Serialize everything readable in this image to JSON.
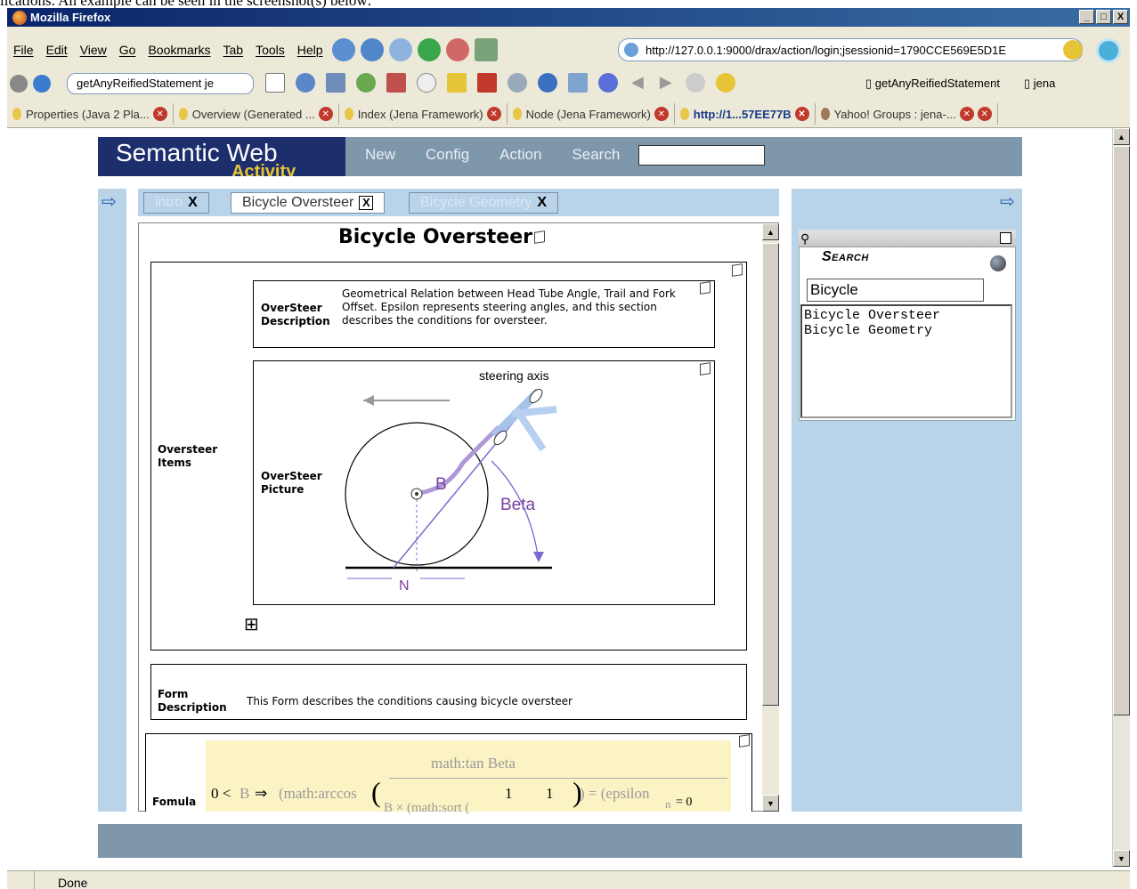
{
  "doc_snippet": "lications. An example can be seen in the screenshot(s) below:",
  "window": {
    "title": "Mozilla Firefox",
    "buttons": [
      "_",
      "□",
      "X"
    ]
  },
  "menu": [
    "File",
    "Edit",
    "View",
    "Go",
    "Bookmarks",
    "Tab",
    "Tools",
    "Help"
  ],
  "url": "http://127.0.0.1:9000/drax/action/login;jsessionid=1790CCE569E5D1E",
  "toolbar2": {
    "search_text": "getAnyReifiedStatement je",
    "bookmark1": "getAnyReifiedStatement",
    "bookmark2": "jena"
  },
  "browser_tabs": [
    {
      "label": "Properties (Java 2 Pla...",
      "active": false
    },
    {
      "label": "Overview (Generated ...",
      "active": false
    },
    {
      "label": "Index (Jena Framework)",
      "active": false
    },
    {
      "label": "Node (Jena Framework)",
      "active": false
    },
    {
      "label": "http://1...57EE77B",
      "active": true
    },
    {
      "label": "Yahoo! Groups : jena-...",
      "active": false
    }
  ],
  "app": {
    "logo": "Semantic Web",
    "logo_sub": "Activity",
    "nav": [
      "New",
      "Config",
      "Action",
      "Search"
    ],
    "tabs": [
      {
        "label": "intro",
        "close": "X",
        "state": "inactive"
      },
      {
        "label": "Bicycle Oversteer",
        "close": "X",
        "state": "active"
      },
      {
        "label": "Bicycle Geometry",
        "close": "X",
        "state": "inactive"
      }
    ],
    "page_title": "Bicycle Oversteer",
    "oversteer_items_label": "Oversteer Items",
    "oversteer_desc_label": "OverSteer Description",
    "oversteer_desc_text": "Geometrical Relation between Head Tube Angle, Trail and Fork Offset. Epsilon represents steering angles, and this section describes the conditions for oversteer.",
    "oversteer_pic_label": "OverSteer Picture",
    "figure_labels": {
      "steering": "steering axis",
      "b": "B",
      "beta": "Beta",
      "n": "N"
    },
    "expand_symbol": "⊞",
    "form_desc_label": "Form Description",
    "form_desc_text": "This Form describes the conditions causing bicycle oversteer",
    "formula_label": "Fomula",
    "formula": {
      "lhs": "0 <",
      "b": "B",
      "arrow": "⇒",
      "arccos": "(math:arccos",
      "tan": "math:tan Beta",
      "num1": "1",
      "num2": "1",
      "eq": ") = (epsilon",
      "sub": "n",
      "eq0": "= 0",
      "denom": "B × (math:sort ("
    },
    "search_widget": {
      "title": "Search",
      "query": "Bicycle",
      "results": [
        "Bicycle Oversteer",
        "Bicycle Geometry"
      ]
    }
  },
  "status": "Done"
}
